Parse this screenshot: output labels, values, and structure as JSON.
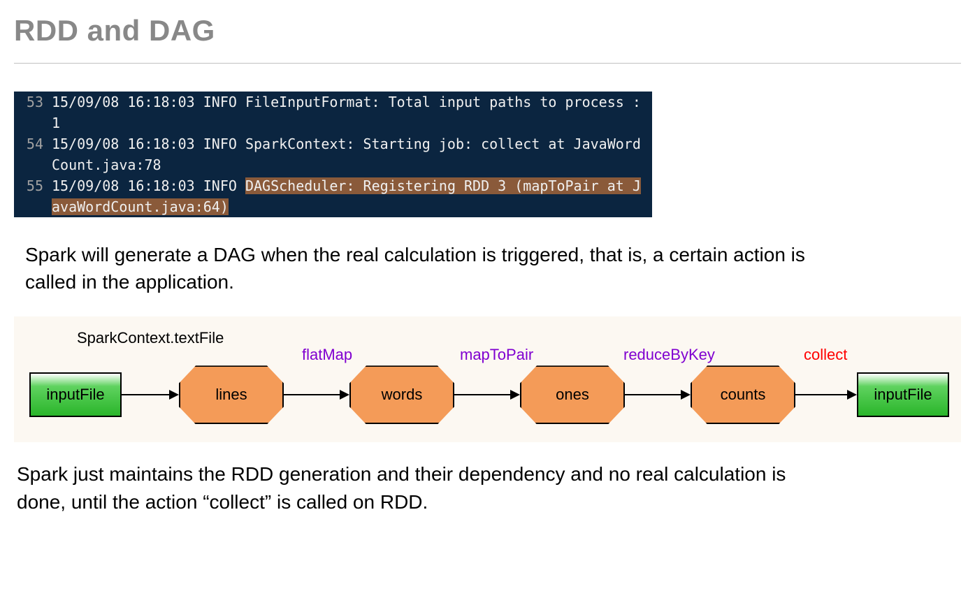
{
  "title": "RDD and DAG",
  "console": {
    "rows": [
      {
        "ln": "53",
        "text": "15/09/08 16:18:03 INFO FileInputFormat: Total input paths to process : 1",
        "hl": ""
      },
      {
        "ln": "54",
        "text": "15/09/08 16:18:03 INFO SparkContext: Starting job: collect at JavaWordCount.java:78",
        "hl": ""
      },
      {
        "ln": "55",
        "text": "15/09/08 16:18:03 INFO ",
        "hl": "DAGScheduler: Registering RDD 3 (mapToPair at JavaWordCount.java:64)"
      }
    ]
  },
  "paragraph1": "Spark will generate a DAG when the real calculation is triggered, that is, a certain action is called in the application.",
  "paragraph2": "Spark just maintains the RDD generation and their dependency and no real calculation is done, until the action “collect” is called on RDD.",
  "diagram": {
    "topLabel": "SparkContext.textFile",
    "ops": {
      "flatMap": "flatMap",
      "mapToPair": "mapToPair",
      "reduceByKey": "reduceByKey",
      "collect": "collect"
    },
    "nodes": {
      "inputFileLeft": "inputFile",
      "lines": "lines",
      "words": "words",
      "ones": "ones",
      "counts": "counts",
      "inputFileRight": "inputFile"
    }
  }
}
